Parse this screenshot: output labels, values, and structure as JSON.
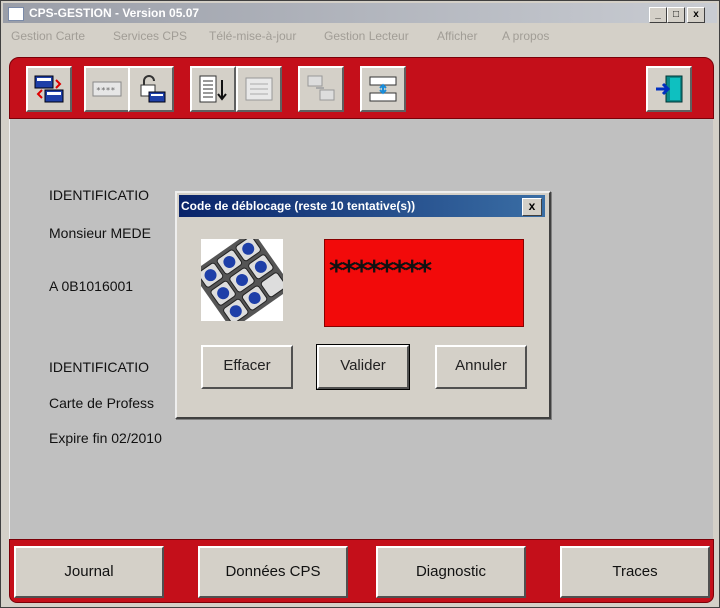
{
  "window": {
    "title": "CPS-GESTION - Version 05.07",
    "minimize": "_",
    "maximize": "□",
    "close": "x"
  },
  "menubar": {
    "items": [
      "Gestion Carte",
      "Services CPS",
      "Télé-mise-à-jour",
      "Gestion Lecteur",
      "Afficher",
      "A propos"
    ]
  },
  "toolbar": {
    "buttons": [
      "card-read-icon",
      "card-pin-icon",
      "card-unlock-icon",
      "sort-list-icon",
      "document-list-icon",
      "copy-card-icon",
      "transfer-icon",
      "exit-door-icon"
    ]
  },
  "content": {
    "ident_heading_1": "IDENTIFICATIO",
    "name": "Monsieur MEDE",
    "number": "A 0B1016001",
    "ident_heading_2": "IDENTIFICATIO",
    "card_type": "Carte de Profess",
    "expiry": "Expire fin 02/2010"
  },
  "dialog": {
    "title": "Code de déblocage (reste 10 tentative(s))",
    "close": "x",
    "pin_value": "********",
    "buttons": {
      "clear": "Effacer",
      "validate": "Valider",
      "cancel": "Annuler"
    }
  },
  "bottombar": {
    "journal": "Journal",
    "donnees": "Données CPS",
    "diagnostic": "Diagnostic",
    "traces": "Traces"
  },
  "colors": {
    "brand_red": "#c40f1a",
    "pin_red": "#f20a0a",
    "dialog_title": "#0a246a"
  }
}
